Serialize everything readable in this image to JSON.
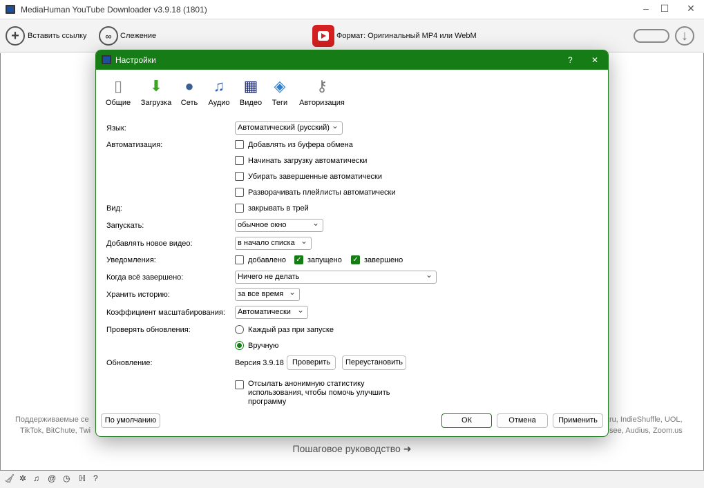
{
  "window": {
    "title": "MediaHuman YouTube Downloader v3.9.18 (1801)"
  },
  "toolbar": {
    "paste_link": "Вставить ссылку",
    "tracking": "Слежение",
    "format": "Формат: Оригинальный MP4 или WebM"
  },
  "main": {
    "supported_left_1": "Поддерживаемые се",
    "supported_left_2": "TikTok, BitChute, Twi",
    "supported_right_1": "ru, IndieShuffle, UOL,",
    "supported_right_2": "see, Audius, Zoom.us",
    "guide": "Пошаговое руководство"
  },
  "dialog": {
    "title": "Настройки",
    "help": "?",
    "close": "✕",
    "tabs": [
      {
        "label": "Общие",
        "icon": "switch-icon"
      },
      {
        "label": "Загрузка",
        "icon": "download-arrow-icon"
      },
      {
        "label": "Сеть",
        "icon": "globe-icon"
      },
      {
        "label": "Аудио",
        "icon": "music-note-icon"
      },
      {
        "label": "Видео",
        "icon": "film-icon"
      },
      {
        "label": "Теги",
        "icon": "tag-icon"
      },
      {
        "label": "Авторизация",
        "icon": "keys-icon"
      }
    ],
    "language": {
      "label": "Язык:",
      "value": "Автоматический (русский)"
    },
    "automation": {
      "label": "Автоматизация:",
      "options": [
        {
          "label": "Добавлять из буфера обмена",
          "checked": false
        },
        {
          "label": "Начинать загрузку автоматически",
          "checked": false
        },
        {
          "label": "Убирать завершенные автоматически",
          "checked": false
        },
        {
          "label": "Разворачивать плейлисты автоматически",
          "checked": false
        }
      ]
    },
    "view": {
      "label": "Вид:",
      "option": "закрывать в трей",
      "checked": false
    },
    "launch": {
      "label": "Запускать:",
      "value": "обычное окно"
    },
    "add_new": {
      "label": "Добавлять новое видео:",
      "value": "в начало списка"
    },
    "notifications": {
      "label": "Уведомления:",
      "options": [
        {
          "label": "добавлено",
          "checked": false
        },
        {
          "label": "запущено",
          "checked": true
        },
        {
          "label": "завершено",
          "checked": true
        }
      ]
    },
    "when_done": {
      "label": "Когда всё завершено:",
      "value": "Ничего не делать"
    },
    "history": {
      "label": "Хранить историю:",
      "value": "за все время"
    },
    "scale": {
      "label": "Коэффициент масштабирования:",
      "value": "Автоматически"
    },
    "check_updates": {
      "label": "Проверять обновления:",
      "options": [
        {
          "label": "Каждый раз при запуске",
          "selected": false
        },
        {
          "label": "Вручную",
          "selected": true
        }
      ]
    },
    "update": {
      "label": "Обновление:",
      "version": "Версия 3.9.18",
      "check": "Проверить",
      "reinstall": "Переустановить"
    },
    "stats": {
      "label": "Отсылать анонимную статистику использования, чтобы помочь улучшить программу",
      "checked": false
    },
    "buttons": {
      "defaults": "По умолчанию",
      "ok": "ОК",
      "cancel": "Отмена",
      "apply": "Применить"
    }
  },
  "colors": {
    "accent": "#167c16",
    "youtube": "#d42020"
  }
}
